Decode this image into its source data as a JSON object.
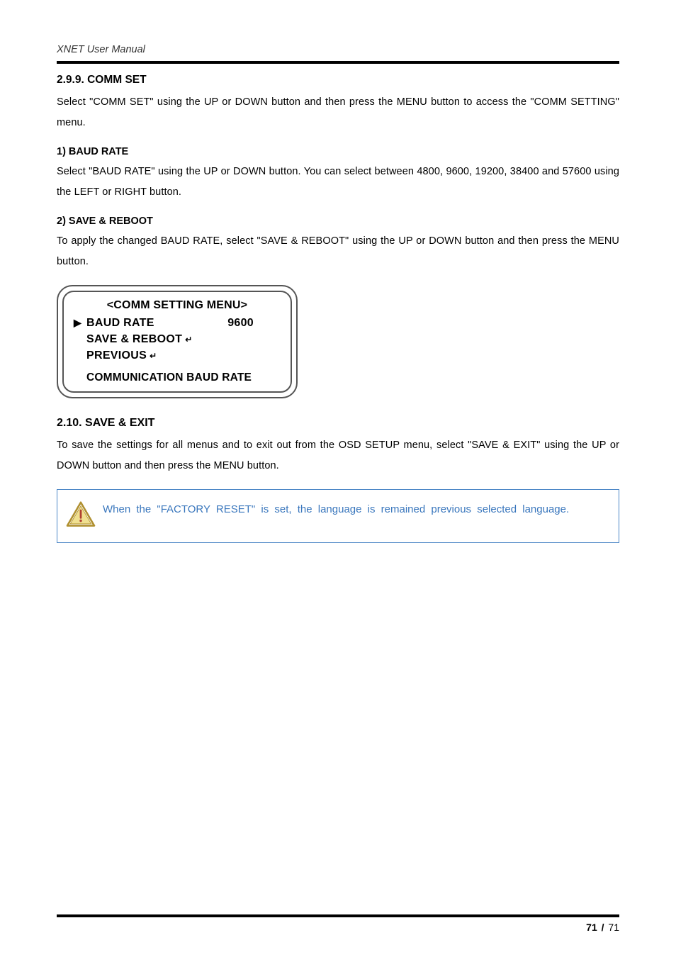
{
  "header": {
    "manual_title": "XNET User Manual"
  },
  "section_299": {
    "heading": "2.9.9. COMM SET",
    "intro": "Select \"COMM SET\" using the UP or DOWN button and then press the MENU button to access the \"COMM SETTING\" menu."
  },
  "baud": {
    "heading": "1) BAUD RATE",
    "text": "Select \"BAUD RATE\" using the UP or DOWN button. You can select between 4800, 9600, 19200, 38400 and 57600 using the LEFT or RIGHT button."
  },
  "save_reboot": {
    "heading": "2) SAVE & REBOOT",
    "text": "To apply the changed BAUD RATE, select \"SAVE & REBOOT\" using the UP or DOWN button and then press the MENU button."
  },
  "osd": {
    "title": "<COMM SETTING MENU>",
    "marker": "▶",
    "row1_label": "BAUD RATE",
    "row1_value": "9600",
    "row2_label": "SAVE & REBOOT",
    "row3_label": "PREVIOUS",
    "return_symbol": "↵",
    "footer": "COMMUNICATION BAUD RATE"
  },
  "section_210": {
    "heading": "2.10. SAVE & EXIT",
    "text": "To save the settings for all menus and to exit out from the OSD SETUP menu, select \"SAVE & EXIT\" using the UP or DOWN button and then press the MENU button."
  },
  "note": {
    "text": "When the \"FACTORY RESET\" is set, the language is remained previous selected language."
  },
  "footer": {
    "current": "71",
    "sep": "/",
    "total": "71"
  }
}
